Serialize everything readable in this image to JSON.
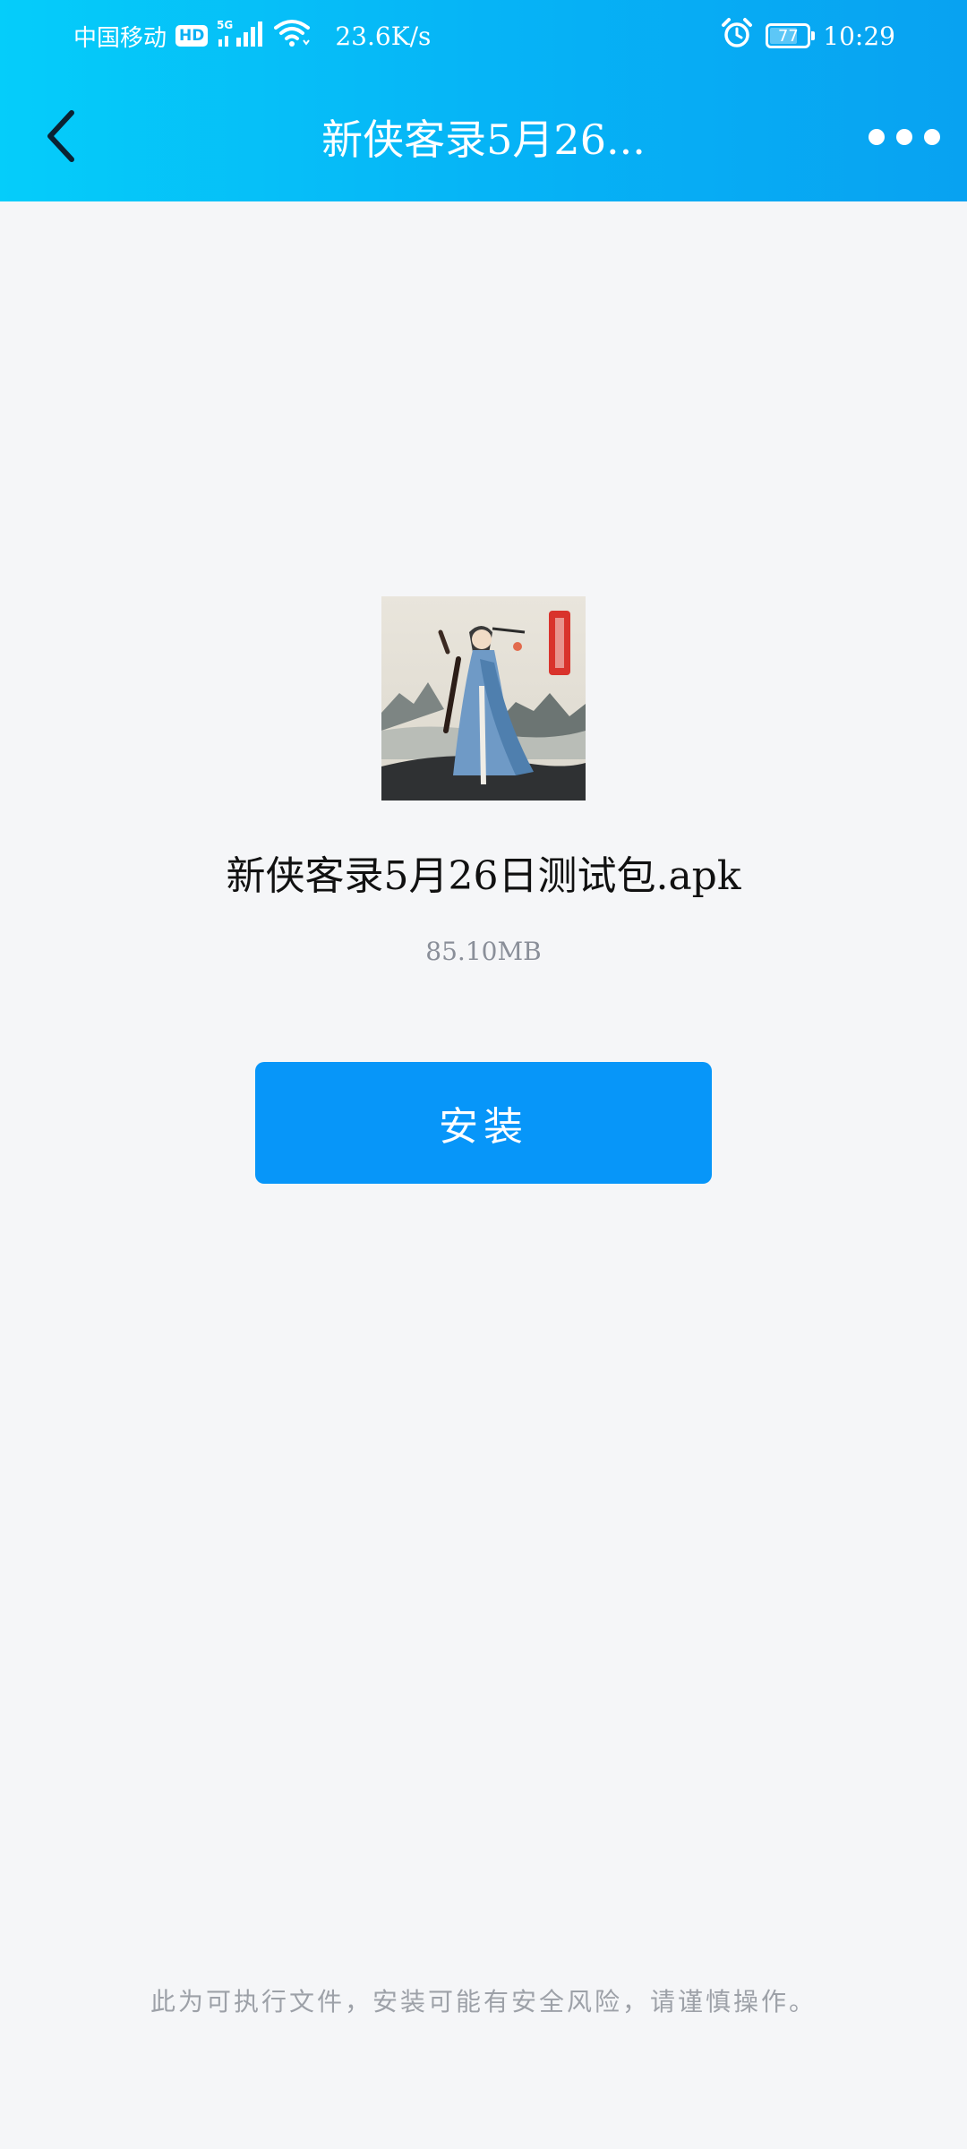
{
  "status_bar": {
    "carrier": "中国移动",
    "hd_badge": "HD",
    "network_type": "5G",
    "net_speed": "23.6K/s",
    "battery_level": "77",
    "time": "10:29",
    "icons": [
      "signal-bars-icon",
      "wifi-icon",
      "alarm-icon",
      "battery-icon"
    ]
  },
  "nav": {
    "title": "新侠客录5月26...",
    "back_icon": "chevron-left-icon",
    "more_icon": "more-dots-icon"
  },
  "file": {
    "name": "新侠客录5月26日测试包.apk",
    "size": "85.10MB",
    "icon": "app-icon-swordsman"
  },
  "install_button": {
    "label": "安装"
  },
  "warning_text": "此为可执行文件，安装可能有安全风险，请谨慎操作。",
  "colors": {
    "header_gradient_start": "#05cdfa",
    "header_gradient_end": "#08a2f1",
    "install_button": "#0796f9",
    "page_background": "#f5f6f8",
    "secondary_text": "#8a8f99"
  }
}
